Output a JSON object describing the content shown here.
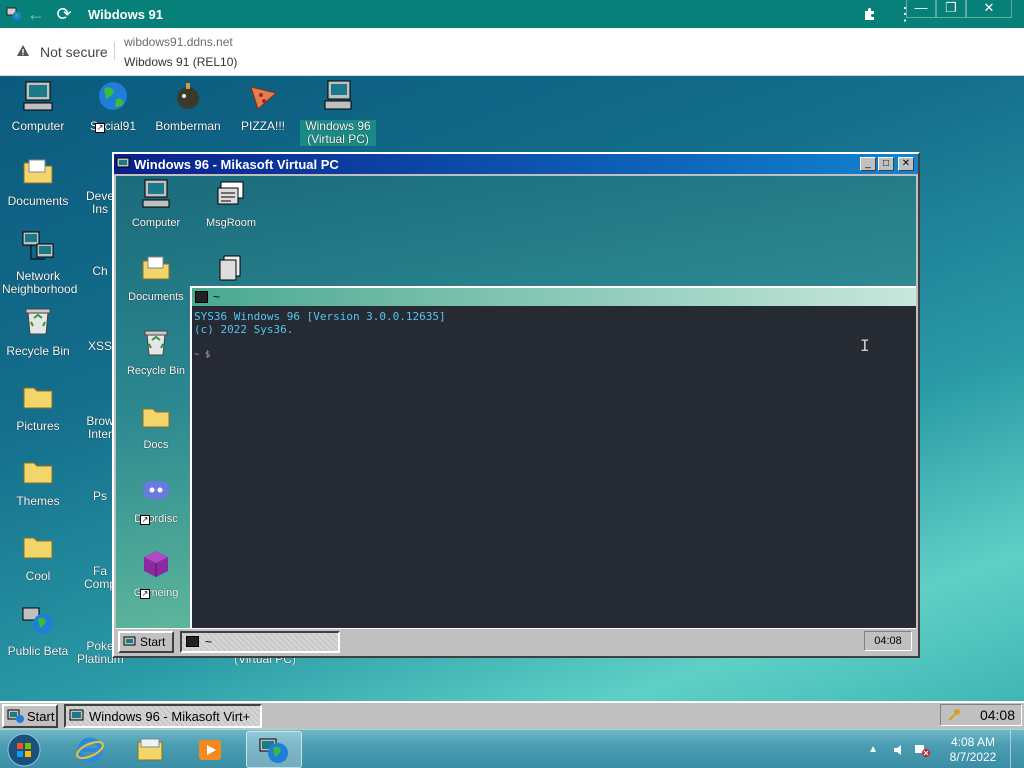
{
  "browser": {
    "tab_title": "Wibdows 91",
    "back_icon": "←",
    "reload_icon": "⟳",
    "extensions_icon": "puzzle-icon",
    "menu_icon": "⋮",
    "win_min": "—",
    "win_restore": "❐",
    "win_close": "✕",
    "security_label": "Not secure",
    "url": "wibdows91.ddns.net",
    "page_title": "Wibdows 91 (REL10)"
  },
  "desktop": {
    "icons": [
      {
        "label": "Computer"
      },
      {
        "label": "Social91"
      },
      {
        "label": "Bomberman"
      },
      {
        "label": "PIZZA!!!"
      },
      {
        "label": "Windows 96 (Virtual PC)"
      },
      {
        "label": "Documents"
      },
      {
        "label": "Deve Ins"
      },
      {
        "label": "Network Neighborhood"
      },
      {
        "label": "Ch"
      },
      {
        "label": "Recycle Bin"
      },
      {
        "label": "XSS"
      },
      {
        "label": "Pictures"
      },
      {
        "label": "Brow Inter"
      },
      {
        "label": "Themes"
      },
      {
        "label": "Ps"
      },
      {
        "label": "Cool"
      },
      {
        "label": "Fa Comp"
      },
      {
        "label": "Public Beta"
      },
      {
        "label": "Poke Platinum"
      },
      {
        "label": "(Virtual PC)"
      }
    ]
  },
  "vpc": {
    "title": "Windows 96 - Mikasoft Virtual PC",
    "min": "_",
    "max": "□",
    "close": "✕",
    "icons": [
      {
        "label": "Computer"
      },
      {
        "label": "MsgRoom"
      },
      {
        "label": "Documents"
      },
      {
        "label": "Recycle Bin"
      },
      {
        "label": "Docs"
      },
      {
        "label": "Doordisc"
      },
      {
        "label": "Gameing"
      }
    ],
    "terminal": {
      "title": "~",
      "line1": "SYS36 Windows 96 [Version 3.0.0.12635]",
      "line2": "(c) 2022 Sys36.",
      "prompt": "~ $"
    },
    "taskbar": {
      "start_label": "Start",
      "task_label": "~",
      "clock": "04:08"
    }
  },
  "w91_taskbar": {
    "start_label": "Start",
    "task_label": "Windows 96 - Mikasoft Virt+",
    "clock": "04:08"
  },
  "w7_taskbar": {
    "time": "4:08 AM",
    "date": "8/7/2022"
  }
}
